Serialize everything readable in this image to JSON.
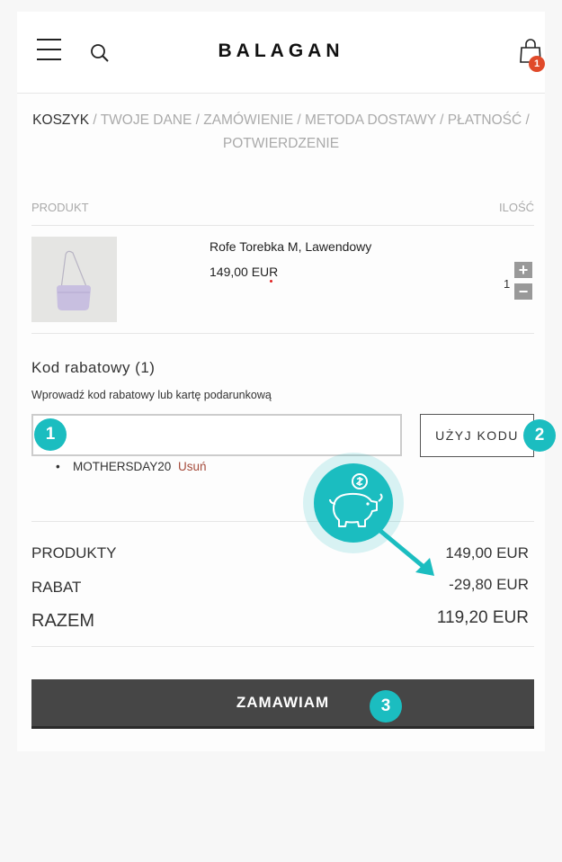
{
  "header": {
    "logo": "BALAGAN",
    "cart_count": "1"
  },
  "breadcrumb": {
    "active": "KOSZYK",
    "rest": " / TWOJE DANE / ZAMÓWIENIE / METODA DOSTAWY / PŁATNOŚĆ / POTWIERDZENIE"
  },
  "table": {
    "col_product": "PRODUKT",
    "col_qty": "ILOŚĆ",
    "item": {
      "name": "Rofe Torebka M, Lawendowy",
      "price": "149,00 EUR",
      "quantity": "1",
      "plus": "+",
      "minus": "−"
    }
  },
  "discount": {
    "title": "Kod rabatowy (1)",
    "hint": "Wprowadź kod rabatowy lub kartę podarunkową",
    "input_value": "",
    "apply_label": "UŻYJ KODU",
    "bullet": "•",
    "applied_code": "MOTHERSDAY20",
    "remove_label": "Usuń"
  },
  "totals": {
    "products_label": "PRODUKTY",
    "products_value": "149,00 EUR",
    "discount_label": "RABAT",
    "discount_value": "-29,80 EUR",
    "total_label": "RAZEM",
    "total_value": "119,20 EUR"
  },
  "order_label": "ZAMAWIAM",
  "callouts": {
    "one": "1",
    "two": "2",
    "three": "3"
  },
  "colors": {
    "accent": "#1bbdc0",
    "badge": "#e04a2a",
    "button": "#464646"
  },
  "icons": [
    "menu-icon",
    "search-icon",
    "shopping-bag-icon",
    "piggy-bank-icon",
    "arrow-icon"
  ]
}
